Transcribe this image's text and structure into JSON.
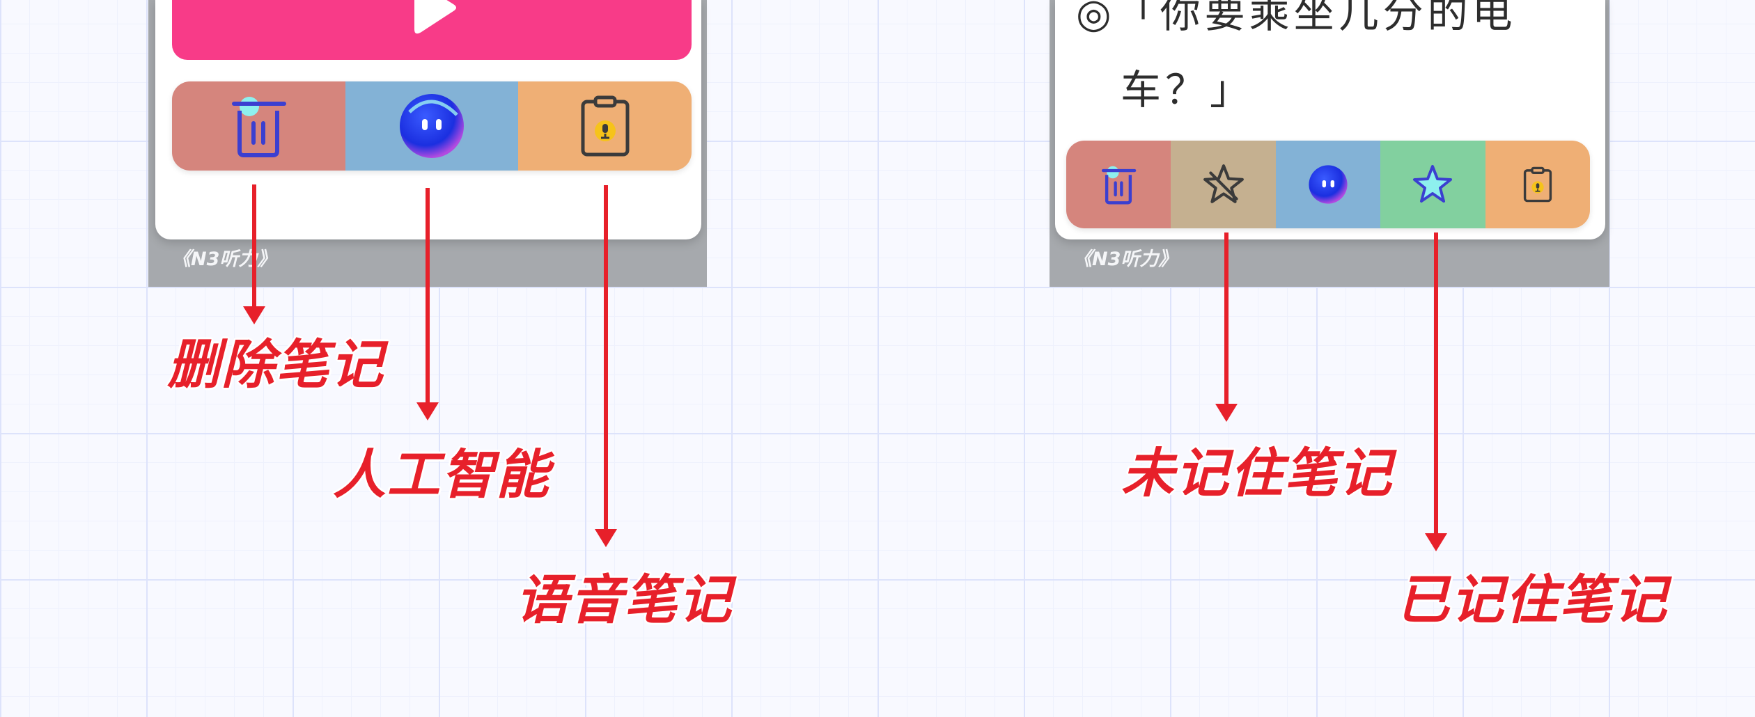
{
  "left_panel": {
    "caption": "《N3听力》",
    "toolbar": [
      {
        "name": "delete",
        "color": "#d5857d",
        "icon": "trash-icon"
      },
      {
        "name": "ai",
        "color": "#83b2d6",
        "icon": "ai-robot-icon"
      },
      {
        "name": "voice",
        "color": "#efaf75",
        "icon": "voice-note-icon"
      }
    ]
  },
  "right_panel": {
    "caption": "《N3听力》",
    "note_text_line1": "◎「你要乘坐几分的电",
    "note_text_line2": "车？」",
    "toolbar": [
      {
        "name": "delete",
        "color": "#d5857d",
        "icon": "trash-icon"
      },
      {
        "name": "not-memorized",
        "color": "#c5b090",
        "icon": "star-outline-icon"
      },
      {
        "name": "ai",
        "color": "#83b2d6",
        "icon": "ai-robot-icon"
      },
      {
        "name": "memorized",
        "color": "#82d09f",
        "icon": "star-filled-icon"
      },
      {
        "name": "voice",
        "color": "#efaf75",
        "icon": "voice-note-icon"
      }
    ]
  },
  "labels": {
    "delete_note": "删除笔记",
    "ai": "人工智能",
    "voice_note": "语音笔记",
    "not_memorized_note": "未记住笔记",
    "memorized_note": "已记住笔记"
  },
  "accent_color": "#e7202a",
  "play_area_color": "#f83b88"
}
